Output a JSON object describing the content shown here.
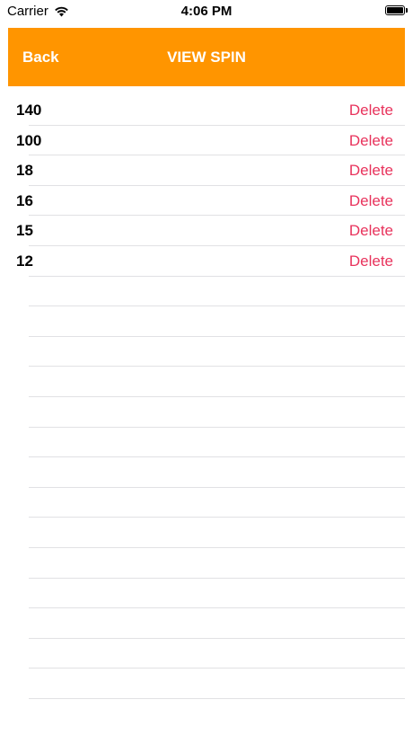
{
  "status_bar": {
    "carrier": "Carrier",
    "time": "4:06 PM"
  },
  "nav": {
    "back_label": "Back",
    "title": "VIEW SPIN",
    "color": "#ff9500"
  },
  "list": {
    "items": [
      {
        "value": "140",
        "action": "Delete"
      },
      {
        "value": "100",
        "action": "Delete"
      },
      {
        "value": "18",
        "action": "Delete"
      },
      {
        "value": "16",
        "action": "Delete"
      },
      {
        "value": "15",
        "action": "Delete"
      },
      {
        "value": "12",
        "action": "Delete"
      }
    ],
    "delete_color": "#e8335c"
  }
}
